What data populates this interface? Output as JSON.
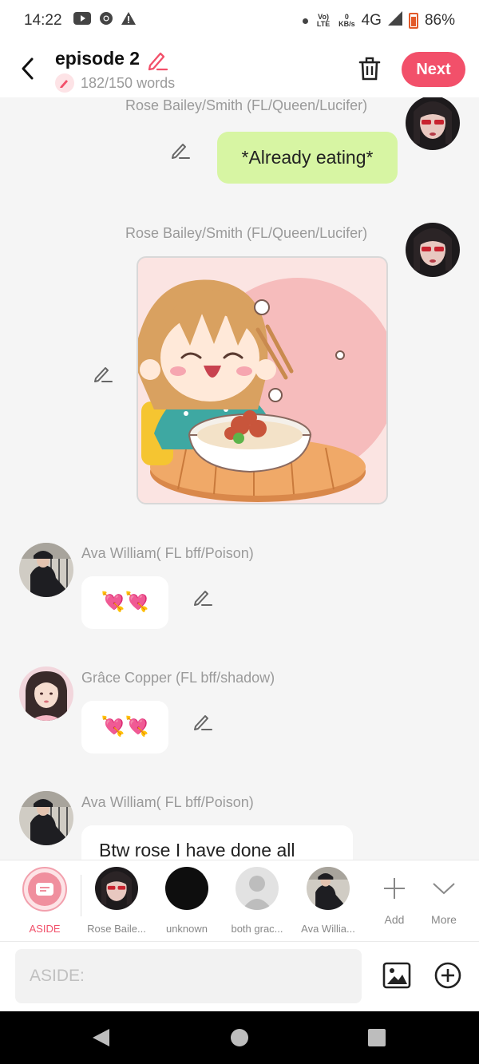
{
  "status_bar": {
    "time": "14:22",
    "network_label": "4G",
    "volte_label": "Vo) LTE",
    "kbs_value": "0",
    "kbs_unit": "KB/s",
    "battery": "86%"
  },
  "header": {
    "title": "episode 2",
    "word_count": "182/150 words",
    "next_label": "Next"
  },
  "messages": [
    {
      "sender": "Rose Bailey/Smith (FL/Queen/Lucifer)",
      "text": "*Already eating*"
    },
    {
      "sender": "Rose Bailey/Smith (FL/Queen/Lucifer)",
      "image": "chibi girl eating noodles"
    },
    {
      "sender": "Ava William( FL bff/Poison)",
      "text": "💘💘"
    },
    {
      "sender": "Grâce Copper (FL bff/shadow)",
      "text": "💘💘"
    },
    {
      "sender": "Ava William( FL bff/Poison)",
      "text": "Btw rose I have done all"
    }
  ],
  "characters": [
    {
      "label": "ASIDE",
      "selected": true
    },
    {
      "label": "Rose Baile..."
    },
    {
      "label": "unknown"
    },
    {
      "label": "both grac..."
    },
    {
      "label": "Ava Willia..."
    }
  ],
  "actions": {
    "add_label": "Add",
    "more_label": "More"
  },
  "input": {
    "placeholder": "ASIDE:"
  },
  "colors": {
    "accent": "#f2506a",
    "bubble_green": "#d7f5a3",
    "bubble_white": "#ffffff",
    "name_gray": "#9a9a9a"
  }
}
